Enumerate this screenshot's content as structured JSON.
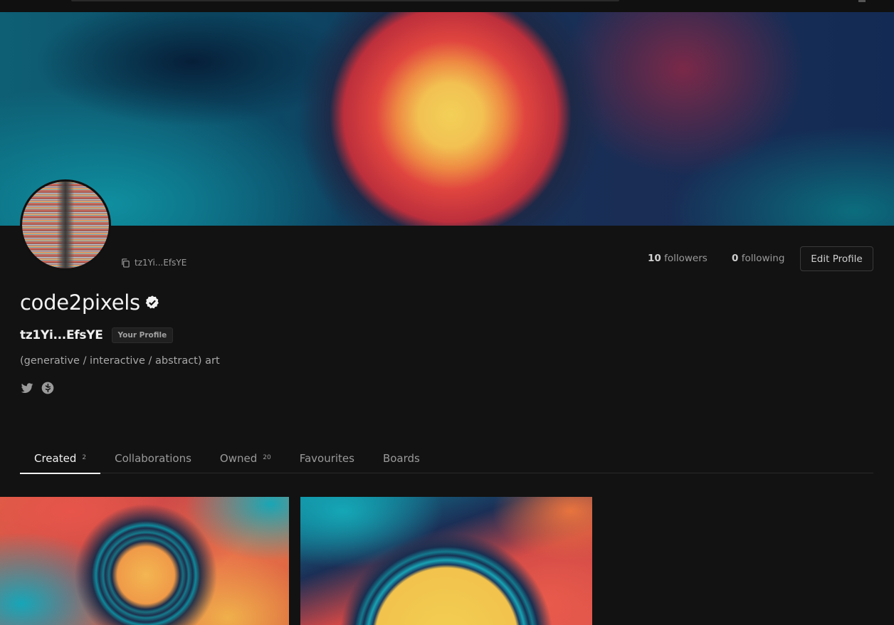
{
  "profile": {
    "short_address": "tz1Yi...EfsYE",
    "username": "code2pixels",
    "address_bold": "tz1Yi...EfsYE",
    "badge": "Your Profile",
    "bio": "(generative / interactive / abstract) art",
    "verified": true
  },
  "stats": {
    "followers_count": "10",
    "followers_label": "followers",
    "following_count": "0",
    "following_label": "following"
  },
  "actions": {
    "edit_profile": "Edit Profile"
  },
  "socials": [
    {
      "icon": "twitter-icon"
    },
    {
      "icon": "website-icon"
    }
  ],
  "tabs": [
    {
      "label": "Created",
      "count": "2",
      "active": true
    },
    {
      "label": "Collaborations",
      "count": ""
    },
    {
      "label": "Owned",
      "count": "20"
    },
    {
      "label": "Favourites",
      "count": ""
    },
    {
      "label": "Boards",
      "count": ""
    }
  ],
  "colors": {
    "background": "#121212",
    "accent_red": "#e0453f",
    "accent_yellow": "#f3d058",
    "accent_teal": "#0f8fa0"
  }
}
